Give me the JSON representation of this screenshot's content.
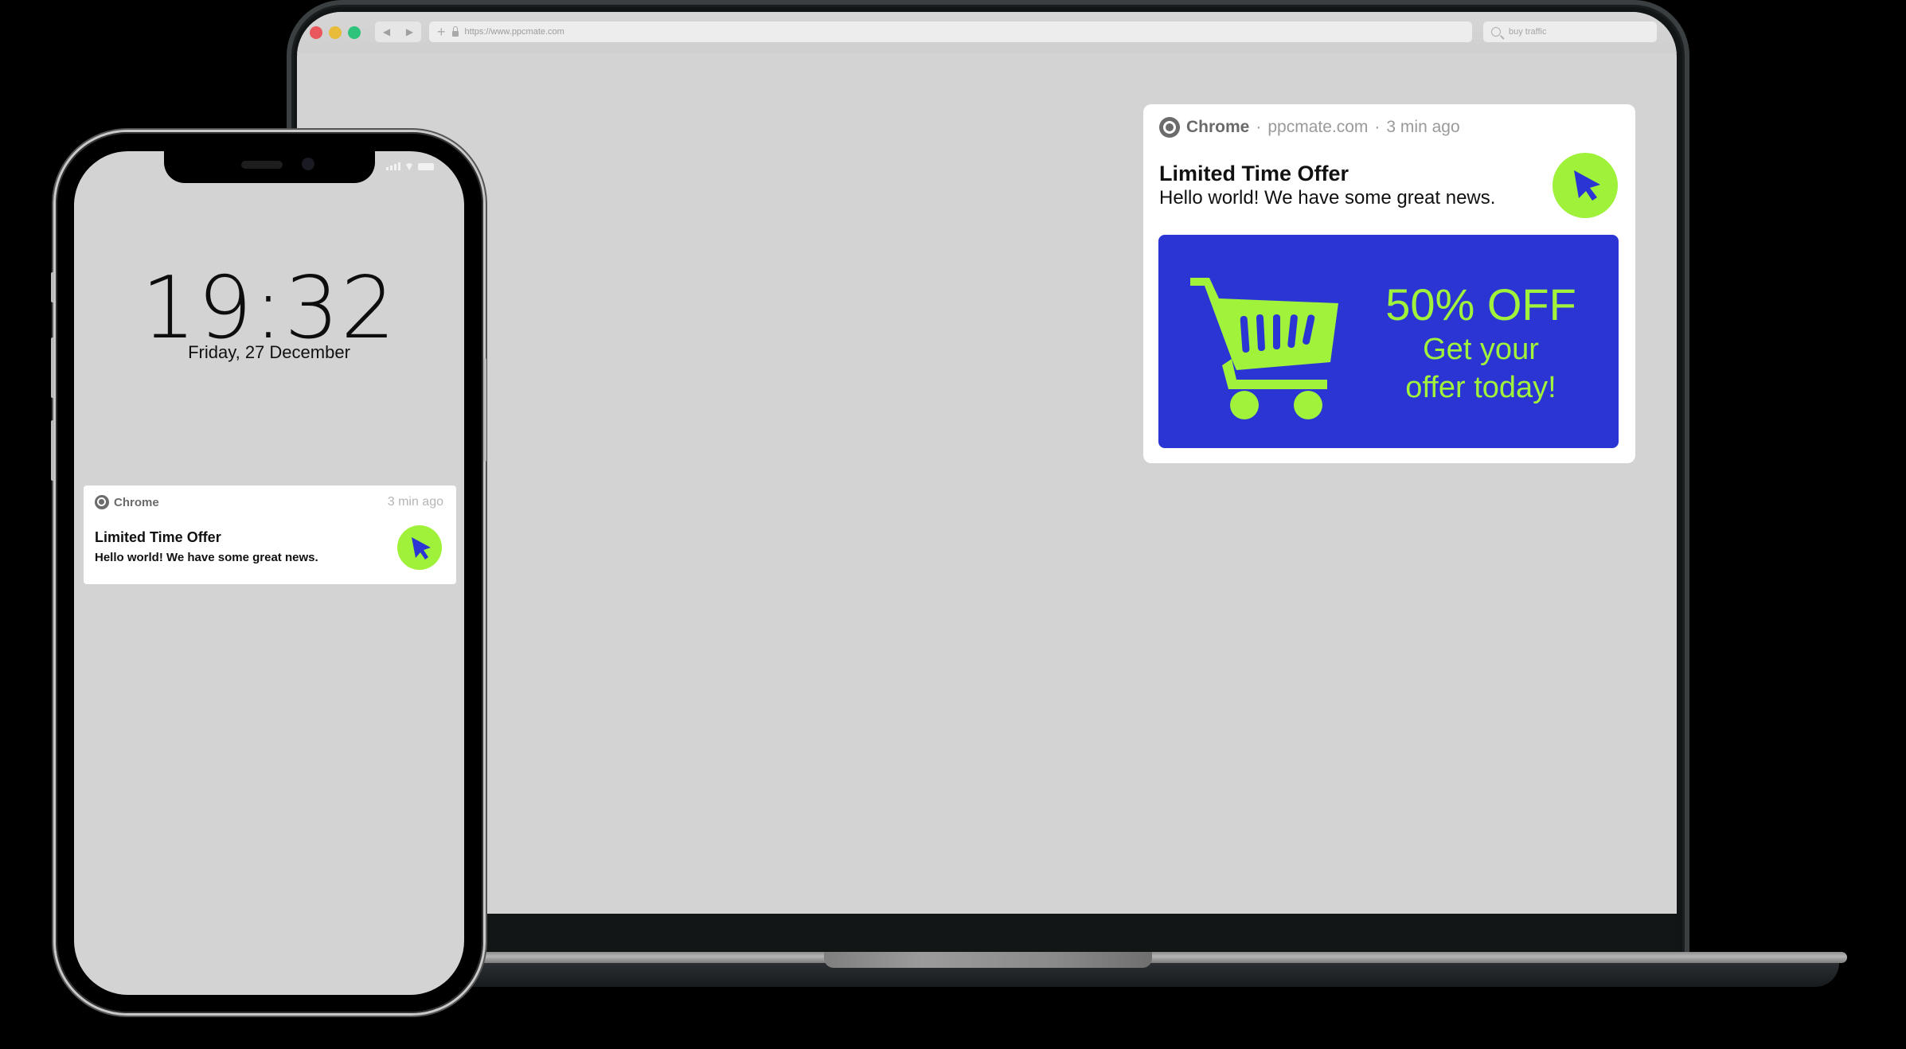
{
  "browser": {
    "url": "https://www.ppcmate.com",
    "search_value": "buy traffic",
    "nav_back": "◀",
    "nav_forward": "▶",
    "new_tab": "+"
  },
  "desktop_notification": {
    "app": "Chrome",
    "separator": "·",
    "domain": "ppcmate.com",
    "time": "3 min ago",
    "title": "Limited Time Offer",
    "body": "Hello world! We have some great news.",
    "icon": "cursor-arrow-icon",
    "banner": {
      "headline": "50% OFF",
      "line1": "Get your",
      "line2": "offer today!",
      "icon": "shopping-cart-icon",
      "background_color": "#2b35d4",
      "accent_color": "#a0f23a"
    }
  },
  "phone": {
    "time": "19:32",
    "date": "Friday, 27 December",
    "notification": {
      "app": "Chrome",
      "time": "3 min ago",
      "title": "Limited Time Offer",
      "body": "Hello world! We have some great news.",
      "icon": "cursor-arrow-icon"
    }
  },
  "colors": {
    "badge_green": "#9ff13a",
    "cursor_blue": "#2b35d4",
    "screen_bg": "#d3d3d3"
  }
}
